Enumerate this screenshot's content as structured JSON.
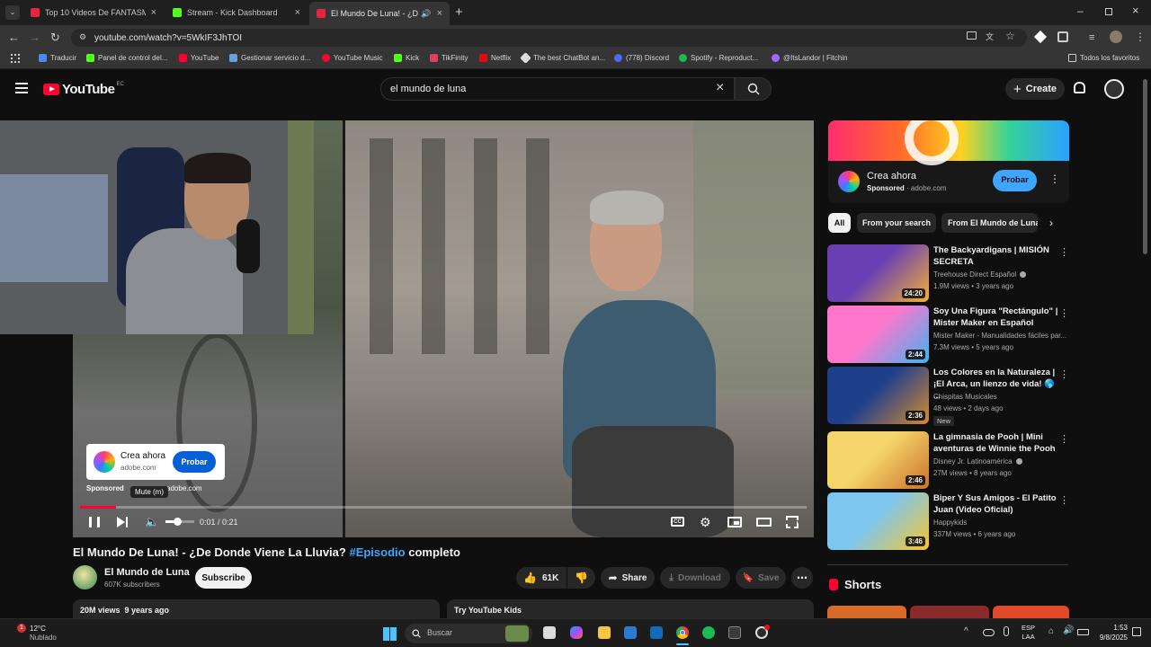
{
  "browser": {
    "tabs": [
      {
        "title": "Top 10 Videos De FANTASMAS",
        "color": "#e6243f"
      },
      {
        "title": "Stream - Kick Dashboard",
        "color": "#53fc18"
      },
      {
        "title": "El Mundo De Luna! - ¿De D",
        "color": "#e6243f"
      }
    ],
    "url": "youtube.com/watch?v=5WkIF3JhTOI",
    "bookmarks": [
      {
        "label": "Traducir",
        "color": "#4a8af4"
      },
      {
        "label": "Panel de control del...",
        "color": "#53fc18"
      },
      {
        "label": "YouTube",
        "color": "#ff0033"
      },
      {
        "label": "Gestionar servicio d...",
        "color": "#6aa0d8"
      },
      {
        "label": "YouTube Music",
        "color": "#ff0033"
      },
      {
        "label": "Kick",
        "color": "#53fc18"
      },
      {
        "label": "TikFinity",
        "color": "#e04060"
      },
      {
        "label": "Netflix",
        "color": "#e50914"
      },
      {
        "label": "The best ChatBot an...",
        "color": "#dddddd"
      },
      {
        "label": "(778) Discord",
        "color": "#5865f2"
      },
      {
        "label": "Spotify - Reproduct...",
        "color": "#1db954"
      },
      {
        "label": "@ItsLandor | Fitchin",
        "color": "#9b6bff"
      }
    ],
    "all_bookmarks": "Todos los favoritos"
  },
  "header": {
    "logo_word": "YouTube",
    "country": "EC",
    "search_value": "el mundo de luna",
    "create_label": "Create"
  },
  "player": {
    "ad": {
      "title": "Crea ahora",
      "domain": "adobe.com",
      "cta": "Probar",
      "sponsored": "Sponsored",
      "sponsored_domain": "adobe.com"
    },
    "tooltip": "Mute (m)",
    "time": "0:01 / 0:21",
    "progress": 0.05,
    "volume": 0.4
  },
  "video": {
    "title_pre": "El Mundo De Luna! - ¿De Donde Viene La Lluvia?",
    "hashtag": "#Episodio",
    "title_post": "completo",
    "channel": "El Mundo de Luna",
    "subscribers": "607K subscribers",
    "subscribe_label": "Subscribe",
    "likes": "61K",
    "share_label": "Share",
    "download_label": "Download",
    "save_label": "Save",
    "views_line": "20M views  9 years ago",
    "kids_line": "Try YouTube Kids"
  },
  "sidebar": {
    "ad": {
      "title": "Crea ahora",
      "sponsored": "Sponsored",
      "domain": "adobe.com",
      "cta": "Probar"
    },
    "chips": [
      "All",
      "From your search",
      "From El Mundo de Luna"
    ],
    "recs": [
      {
        "title": "The Backyardigans | MISIÓN SECRETA",
        "channel": "Treehouse Direct Español",
        "meta": "1.9M views • 3 years ago",
        "duration": "24:20",
        "colors": [
          "#6a3fb4",
          "#f2b233"
        ],
        "verified": true,
        "badge": ""
      },
      {
        "title": "Soy Una Figura \"Rectángulo\" | Mister Maker en Español",
        "channel": "Mister Maker - Manualidades fáciles par...",
        "meta": "7.3M views • 5 years ago",
        "duration": "2:44",
        "colors": [
          "#ff77cc",
          "#3fb3f0"
        ],
        "verified": false,
        "badge": ""
      },
      {
        "title": "Los Colores en la Naturaleza | ¡El Arca, un lienzo de vida! 🌎 ...",
        "channel": "Chispitas Musicales",
        "meta": "48 views • 2 days ago",
        "duration": "2:36",
        "colors": [
          "#1f3f8c",
          "#d58a2f"
        ],
        "verified": false,
        "badge": "New"
      },
      {
        "title": "La gimnasia de Pooh | Mini aventuras de Winnie the Pooh",
        "channel": "Disney Jr. Latinoamérica",
        "meta": "27M views • 8 years ago",
        "duration": "2:46",
        "colors": [
          "#f6d56a",
          "#c9732a"
        ],
        "verified": true,
        "badge": ""
      },
      {
        "title": "Biper Y Sus Amigos - El Patito Juan (Video Oficial)",
        "channel": "Happykids",
        "meta": "337M views • 6 years ago",
        "duration": "3:46",
        "colors": [
          "#7dc6f0",
          "#f7c52d"
        ],
        "verified": false,
        "badge": ""
      }
    ],
    "shorts_label": "Shorts"
  },
  "taskbar": {
    "weather_temp": "12°C",
    "weather_desc": "Nublado",
    "weather_badge": "1",
    "search_placeholder": "Buscar",
    "lang_top": "ESP",
    "lang_bottom": "LAA",
    "time": "1:53",
    "date": "9/8/2025"
  }
}
